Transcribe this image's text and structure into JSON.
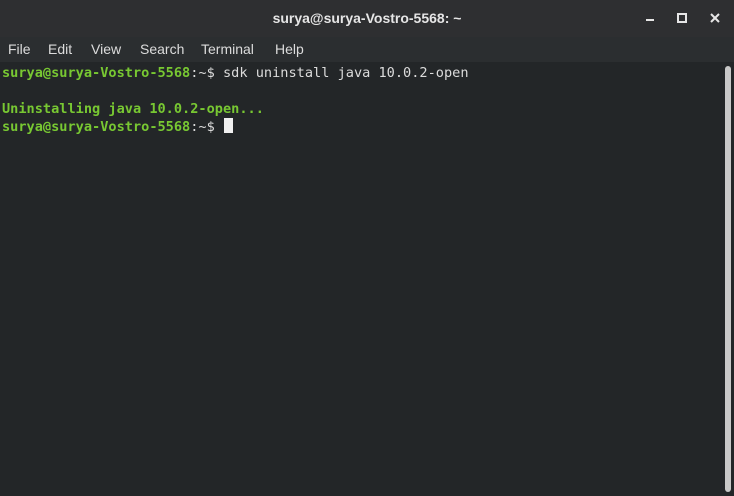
{
  "window": {
    "title": "surya@surya-Vostro-5568: ~",
    "controls": [
      "minimize-icon",
      "maximize-icon",
      "close-icon"
    ]
  },
  "menu": {
    "items": [
      "File",
      "Edit",
      "View",
      "Search",
      "Terminal",
      "Help"
    ]
  },
  "terminal": {
    "lines": [
      {
        "user_host": "surya@surya-Vostro-5568",
        "path": ":~$",
        "command": " sdk uninstall java 10.0.2-open"
      },
      {
        "output": "Uninstalling java 10.0.2-open..."
      },
      {
        "user_host": "surya@surya-Vostro-5568",
        "path": ":~$",
        "command": " "
      }
    ]
  },
  "colors": {
    "background": "#232628",
    "prompt_green": "#78c832",
    "text": "#dcdcdc",
    "titlebar": "#2e2f31"
  }
}
